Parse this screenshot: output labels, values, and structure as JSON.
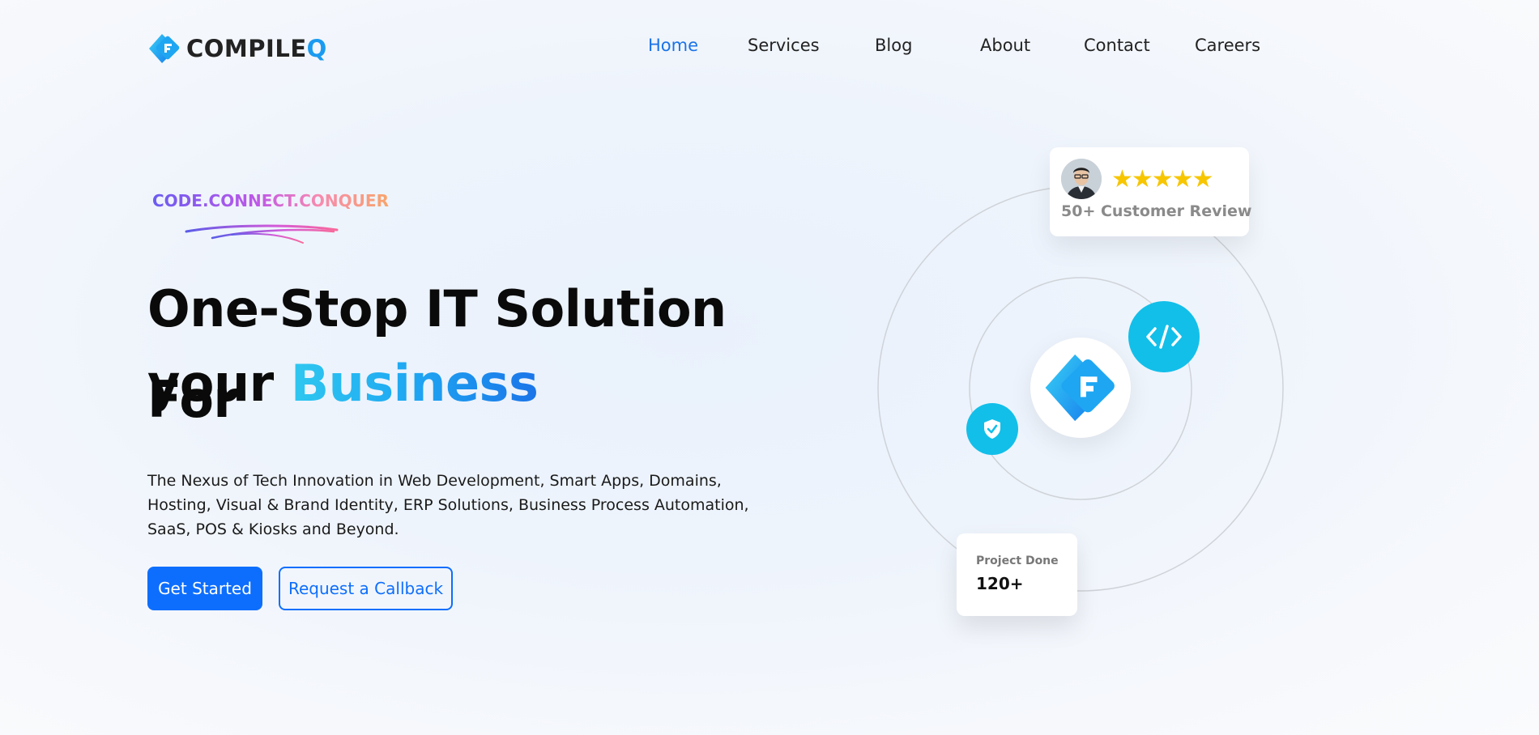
{
  "brand": {
    "name_main": "COMPILE",
    "name_accent": "Q",
    "accent_color": "#1a9bf0"
  },
  "nav": {
    "items": [
      {
        "label": "Home",
        "active": true
      },
      {
        "label": "Services",
        "active": false
      },
      {
        "label": "Blog",
        "active": false
      },
      {
        "label": "About",
        "active": false
      },
      {
        "label": "Contact",
        "active": false
      },
      {
        "label": "Careers",
        "active": false
      }
    ],
    "active_color": "#1a73e8"
  },
  "hero": {
    "tagline": "CODE.CONNECT.CONQUER",
    "headline_line1": "One-Stop IT Solution For",
    "headline_line2_plain": "your ",
    "headline_line2_highlight": "Business",
    "description": "The Nexus of Tech Innovation in Web Development, Smart Apps, Domains, Hosting, Visual & Brand Identity, ERP Solutions, Business Process Automation, SaaS, POS & Kiosks and Beyond.",
    "primary_button": "Get Started",
    "secondary_button": "Request a Callback",
    "primary_color": "#0d6efd"
  },
  "visual": {
    "review_card": {
      "stars": "★★★★★",
      "rating": 5,
      "text": "50+ Customer Review",
      "avatar_icon": "user-avatar"
    },
    "project_card": {
      "label": "Project Done",
      "value": "120+"
    },
    "badges": [
      {
        "icon": "code-icon",
        "color": "#12bfe9"
      },
      {
        "icon": "shield-check-icon",
        "color": "#12bfe9"
      }
    ],
    "center_icon": "compileq-logo-icon"
  }
}
